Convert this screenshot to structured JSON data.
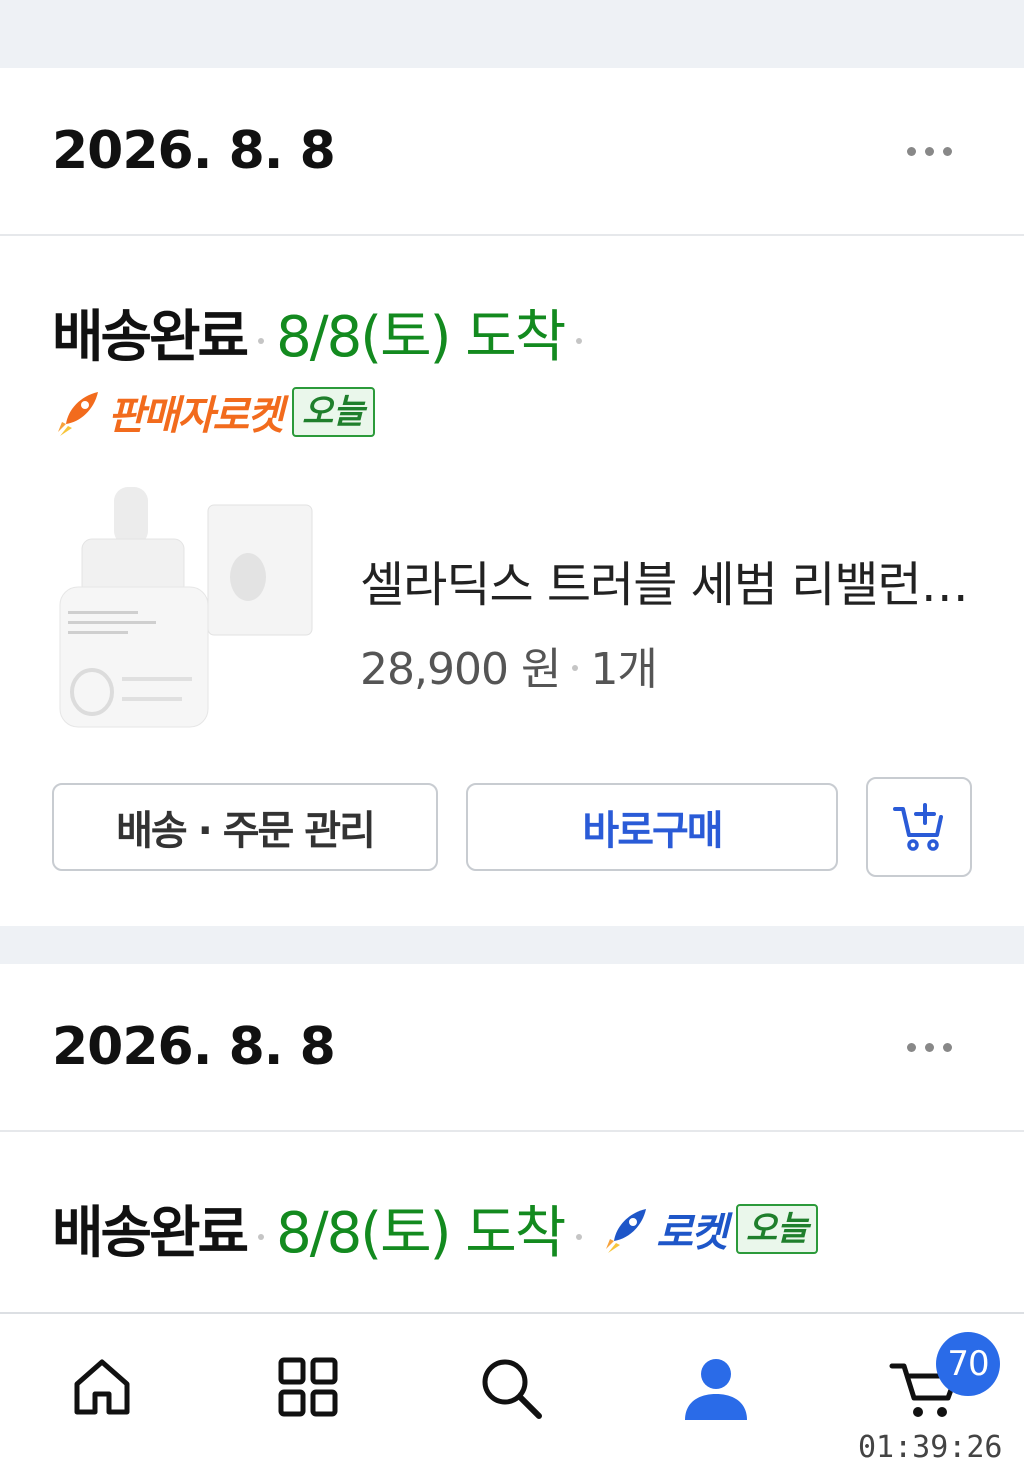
{
  "orders": [
    {
      "date": "2026. 8. 8",
      "status": "배송완료",
      "arrival": "8/8(토) 도착",
      "delivery_type": "판매자로켓",
      "today_tag": "오늘",
      "product": {
        "name": "셀라딕스 트러블 세범 리밸런싱 앰플",
        "price": "28,900 원",
        "quantity": "1개"
      },
      "actions": {
        "manage_label": "배송 · 주문 관리",
        "buy_label": "바로구매"
      }
    },
    {
      "date": "2026. 8. 8",
      "status": "배송완료",
      "arrival": "8/8(토) 도착",
      "delivery_type": "로켓",
      "today_tag": "오늘"
    }
  ],
  "nav": {
    "items": [
      "home-icon",
      "category-icon",
      "search-icon",
      "my-page-icon",
      "cart-icon"
    ],
    "active": "my-page",
    "cart_count": "70"
  },
  "status_bar": {
    "time": "01:39:26"
  },
  "colors": {
    "arrival_green": "#138a1f",
    "seller_rocket_orange": "#f26b1d",
    "rocket_blue": "#1e56c8",
    "active_nav_blue": "#2a6be8"
  }
}
